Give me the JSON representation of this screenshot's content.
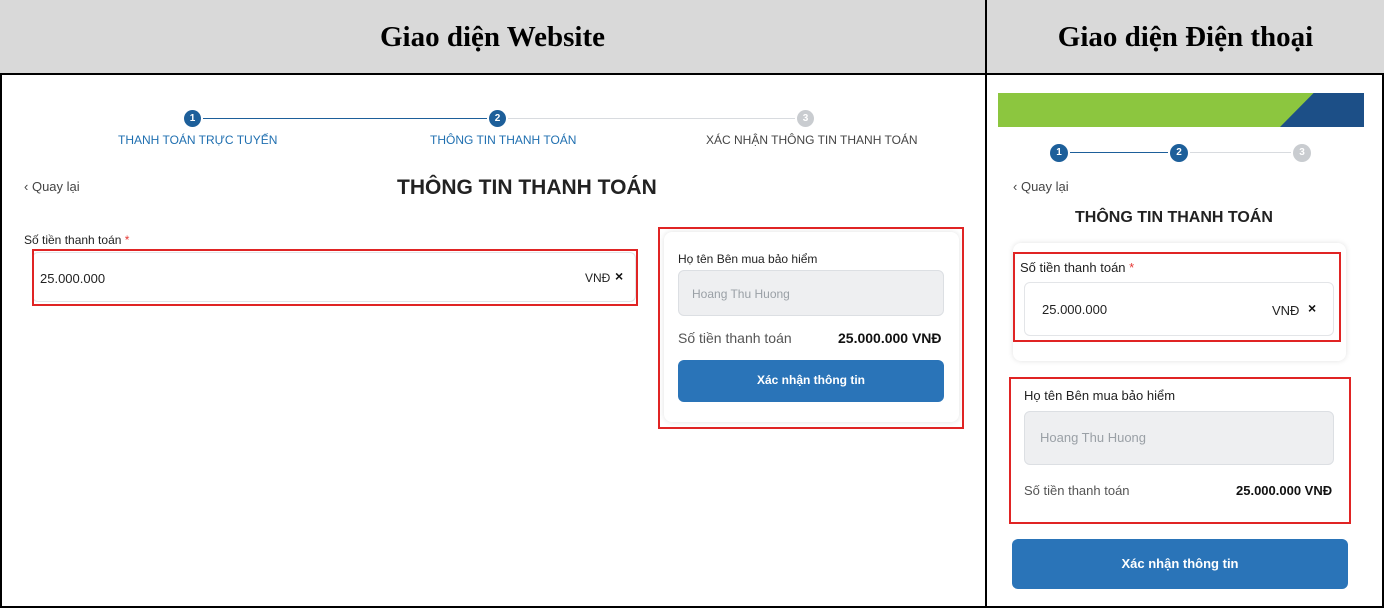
{
  "table": {
    "col_website_title": "Giao diện Website",
    "col_mobile_title": "Giao diện Điện thoại"
  },
  "website": {
    "steps": [
      {
        "number": "1",
        "label": "THANH TOÁN TRỰC TUYẾN",
        "state": "done"
      },
      {
        "number": "2",
        "label": "THÔNG TIN THANH TOÁN",
        "state": "active"
      },
      {
        "number": "3",
        "label": "XÁC NHẬN THÔNG TIN THANH TOÁN",
        "state": "pending"
      }
    ],
    "back_label": "Quay lại",
    "page_title": "THÔNG TIN THANH TOÁN",
    "amount_label": "Số tiền thanh toán",
    "required_mark": "*",
    "amount_value": "25.000.000",
    "currency": "VNĐ",
    "clear_icon": "×",
    "buyer_label": "Họ tên Bên mua bảo hiểm",
    "buyer_value": "Hoang Thu Huong",
    "summary_label": "Số tiền thanh toán",
    "summary_value": "25.000.000 VNĐ",
    "confirm_button": "Xác nhận thông tin"
  },
  "mobile": {
    "steps": [
      {
        "number": "1",
        "state": "done"
      },
      {
        "number": "2",
        "state": "active"
      },
      {
        "number": "3",
        "state": "pending"
      }
    ],
    "back_label": "Quay lại",
    "page_title": "THÔNG TIN THANH TOÁN",
    "amount_label": "Số tiền thanh toán",
    "required_mark": "*",
    "amount_value": "25.000.000",
    "currency": "VNĐ",
    "clear_icon": "×",
    "buyer_label": "Họ tên Bên mua bảo hiểm",
    "buyer_value": "Hoang Thu Huong",
    "summary_label": "Số tiền thanh toán",
    "summary_value": "25.000.000 VNĐ",
    "confirm_button": "Xác nhận thông tin"
  },
  "colors": {
    "primary": "#2a74b8",
    "step_active": "#1d5f9a",
    "step_idle": "#c9ccd0",
    "highlight": "#e02424",
    "banner_green": "#8cc63f",
    "banner_blue": "#1c4f87"
  }
}
